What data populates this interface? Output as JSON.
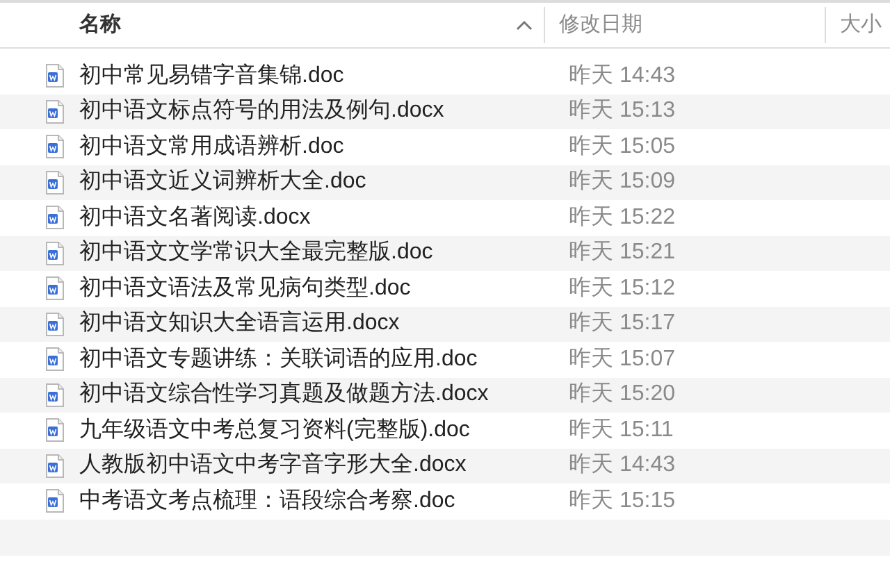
{
  "columns": [
    {
      "label": "名称",
      "sorted": true
    },
    {
      "label": "修改日期",
      "sorted": false
    },
    {
      "label": "大小",
      "sorted": false
    }
  ],
  "files": [
    {
      "name": "初中常见易错字音集锦.doc",
      "modified": "昨天 14:43"
    },
    {
      "name": "初中语文标点符号的用法及例句.docx",
      "modified": "昨天 15:13"
    },
    {
      "name": "初中语文常用成语辨析.doc",
      "modified": "昨天 15:05"
    },
    {
      "name": "初中语文近义词辨析大全.doc",
      "modified": "昨天 15:09"
    },
    {
      "name": "初中语文名著阅读.docx",
      "modified": "昨天 15:22"
    },
    {
      "name": "初中语文文学常识大全最完整版.doc",
      "modified": "昨天 15:21"
    },
    {
      "name": "初中语文语法及常见病句类型.doc",
      "modified": "昨天 15:12"
    },
    {
      "name": "初中语文知识大全语言运用.docx",
      "modified": "昨天 15:17"
    },
    {
      "name": "初中语文专题讲练：关联词语的应用.doc",
      "modified": "昨天 15:07"
    },
    {
      "name": "初中语文综合性学习真题及做题方法.docx",
      "modified": "昨天 15:20"
    },
    {
      "name": "九年级语文中考总复习资料(完整版).doc",
      "modified": "昨天 15:11"
    },
    {
      "name": "人教版初中语文中考字音字形大全.docx",
      "modified": "昨天 14:43"
    },
    {
      "name": "中考语文考点梳理：语段综合考察.doc",
      "modified": "昨天 15:15"
    }
  ]
}
